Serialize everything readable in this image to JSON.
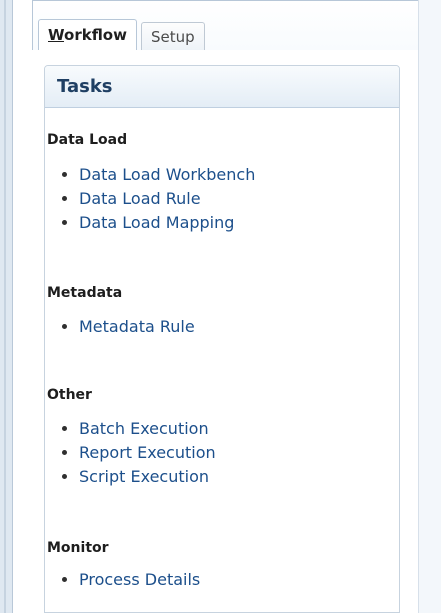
{
  "tabs": [
    {
      "label": "Workflow",
      "active": true
    },
    {
      "label": "Setup",
      "active": false
    }
  ],
  "panel": {
    "title": "Tasks"
  },
  "sections": {
    "data_load": {
      "title": "Data Load",
      "items": [
        "Data Load Workbench",
        "Data Load Rule",
        "Data Load Mapping"
      ]
    },
    "metadata": {
      "title": "Metadata",
      "items": [
        "Metadata Rule"
      ]
    },
    "other": {
      "title": "Other",
      "items": [
        "Batch Execution",
        "Report Execution",
        "Script Execution"
      ]
    },
    "monitor": {
      "title": "Monitor",
      "items": [
        "Process Details"
      ]
    }
  },
  "colors": {
    "link": "#1c4f8b",
    "header_text": "#1f3f63",
    "panel_border": "#c7d3df"
  }
}
